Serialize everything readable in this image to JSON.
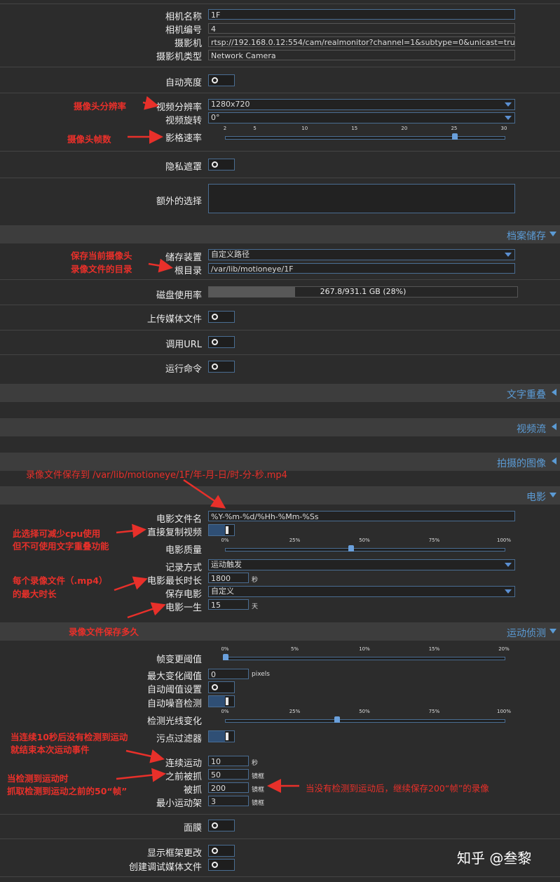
{
  "camera": {
    "name_label": "相机名称",
    "name_value": "1F",
    "id_label": "相机编号",
    "id_value": "4",
    "url_label": "摄影机",
    "url_value": "rtsp://192.168.0.12:554/cam/realmonitor?channel=1&subtype=0&unicast=true&p",
    "type_label": "摄影机类型",
    "type_value": "Network Camera",
    "auto_brightness_label": "自动亮度",
    "auto_brightness": false,
    "resolution_label": "视频分辨率",
    "resolution_value": "1280x720",
    "rotation_label": "视频旋转",
    "rotation_value": "0°",
    "framerate_label": "影格速率",
    "framerate_ticks": [
      "2",
      "5",
      "10",
      "15",
      "20",
      "25",
      "30"
    ],
    "framerate_value": 25,
    "privacy_mask_label": "隐私遮罩",
    "privacy_mask": false,
    "extra_label": "额外的选择",
    "extra_value": ""
  },
  "storage_section": {
    "title": "档案储存",
    "expanded": true
  },
  "storage": {
    "device_label": "储存装置",
    "device_value": "自定义路径",
    "root_label": "根目录",
    "root_value": "/var/lib/motioneye/1F",
    "disk_label": "磁盘使用率",
    "disk_text": "267.8/931.1 GB (28%)",
    "disk_percent": 28,
    "upload_label": "上传媒体文件",
    "upload": false,
    "webhook_label": "调用URL",
    "webhook": false,
    "command_label": "运行命令",
    "command": false
  },
  "text_overlay_section": {
    "title": "文字重叠",
    "expanded": false
  },
  "streaming_section": {
    "title": "视频流",
    "expanded": false
  },
  "still_images_section": {
    "title": "拍摄的图像",
    "expanded": false
  },
  "movies_section": {
    "title": "电影",
    "expanded": true
  },
  "movies": {
    "filename_label": "电影文件名",
    "filename_value": "%Y-%m-%d/%Hh-%Mm-%Ss",
    "passthrough_label": "直接复制视频",
    "passthrough": true,
    "quality_label": "电影质量",
    "quality_ticks": [
      "0%",
      "25%",
      "50%",
      "75%",
      "100%"
    ],
    "quality_value": 45,
    "mode_label": "记录方式",
    "mode_value": "运动触发",
    "maxlen_label": "电影最长时长",
    "maxlen_value": "1800",
    "maxlen_unit": "秒",
    "preserve_label": "保存电影",
    "preserve_value": "自定义",
    "lifetime_label": "电影一生",
    "lifetime_value": "15",
    "lifetime_unit": "天"
  },
  "motion_section": {
    "title": "运动侦测",
    "expanded": true
  },
  "motion": {
    "threshold_label": "帧变更阈值",
    "threshold_ticks": [
      "0%",
      "5%",
      "10%",
      "15%",
      "20%"
    ],
    "threshold_value": 0,
    "max_change_label": "最大变化阈值",
    "max_change_value": "0",
    "max_change_unit": "pixels",
    "auto_threshold_label": "自动阈值设置",
    "auto_threshold": false,
    "auto_noise_label": "自动噪音检测",
    "auto_noise": true,
    "light_switch_label": "检测光线变化",
    "light_switch_ticks": [
      "0%",
      "25%",
      "50%",
      "75%",
      "100%"
    ],
    "light_switch_value": 40,
    "despeckle_label": "污点过滤器",
    "despeckle": true,
    "event_gap_label": "连续运动",
    "event_gap_value": "10",
    "event_gap_unit": "秒",
    "pre_capture_label": "之前被抓",
    "pre_capture_value": "50",
    "pre_capture_unit": "镜框",
    "post_capture_label": "被抓",
    "post_capture_value": "200",
    "post_capture_unit": "镜框",
    "min_frames_label": "最小运动架",
    "min_frames_value": "3",
    "min_frames_unit": "镜框",
    "mask_label": "面膜",
    "mask": false,
    "show_frame_changes_label": "显示框架更改",
    "show_frame_changes": false,
    "debug_media_label": "创建调试媒体文件",
    "debug_media": false
  },
  "annotations": {
    "resolution": "摄像头分辨率",
    "framerate": "摄像头帧数",
    "storage_line1": "保存当前摄像头",
    "storage_line2": "录像文件的目录",
    "movie_path": "录像文件保存到 /var/lib/motioneye/1F/年-月-日/时-分-秒.mp4",
    "passthrough_line1": "此选择可减少cpu使用",
    "passthrough_line2": "但不可使用文字重叠功能",
    "maxlen_line1": "每个录像文件（.mp4）",
    "maxlen_line2": "的最大时长",
    "lifetime": "录像文件保存多久",
    "gap_line1": "当连续10秒后没有检测到运动",
    "gap_line2": "就结束本次运动事件",
    "pre_line1": "当检测到运动时",
    "pre_line2": "抓取检测到运动之前的50“帧”",
    "post": "当没有检测到运动后，继续保存200“帧”的录像"
  },
  "watermark": "知乎 @叁黎"
}
